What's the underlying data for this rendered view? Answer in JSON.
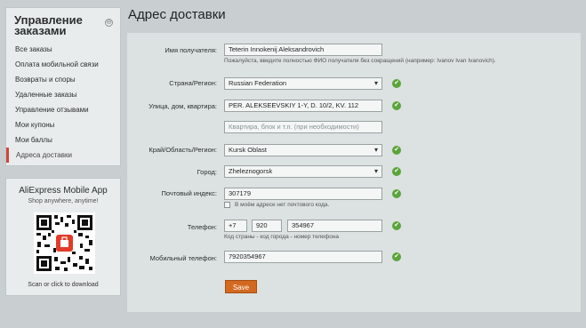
{
  "sidebar": {
    "title": "Управление заказами",
    "collapse_symbol": "⊖",
    "items": [
      {
        "label": "Все заказы"
      },
      {
        "label": "Оплата мобильной связи"
      },
      {
        "label": "Возвраты и споры"
      },
      {
        "label": "Удаленные заказы"
      },
      {
        "label": "Управление отзывами"
      },
      {
        "label": "Мои купоны"
      },
      {
        "label": "Мои баллы"
      },
      {
        "label": "Адреса доставки",
        "active": true
      }
    ]
  },
  "app_promo": {
    "title": "AliExpress Mobile App",
    "subtitle": "Shop anywhere, anytime!",
    "caption": "Scan or click to download"
  },
  "page": {
    "title": "Адрес доставки"
  },
  "form": {
    "recipient": {
      "label": "Имя получателя:",
      "value": "Teterin Innokenij Aleksandrovich",
      "hint": "Пожалуйста, введите полностью ФИО получателя без сокращений (например: Ivanov Ivan Ivanovich)."
    },
    "country": {
      "label": "Страна/Регион:",
      "value": "Russian Federation"
    },
    "street": {
      "label": "Улица, дом, квартира:",
      "value": "PER. ALEKSEEVSKIY 1-Y, D. 10/2, KV. 112",
      "apt_placeholder": "Квартира, блок и т.п. (при необходимости)"
    },
    "region": {
      "label": "Край/Область/Регион:",
      "value": "Kursk Oblast"
    },
    "city": {
      "label": "Город:",
      "value": "Zheleznogorsk"
    },
    "postal": {
      "label": "Почтовый индекс:",
      "value": "307179",
      "no_postal_label": "В моём адресе нет почтового кода."
    },
    "phone": {
      "label": "Телефон:",
      "country_code": "+7",
      "area_code": "920",
      "number": "354967",
      "hint": "Код страны - код города - номер телефона"
    },
    "mobile": {
      "label": "Мобильный телефон:",
      "value": "7920354967"
    },
    "save_label": "Save",
    "check_symbol": "✔"
  },
  "colors": {
    "accent": "#d2691e",
    "active_marker": "#d0453c",
    "valid": "#5aa53a"
  }
}
